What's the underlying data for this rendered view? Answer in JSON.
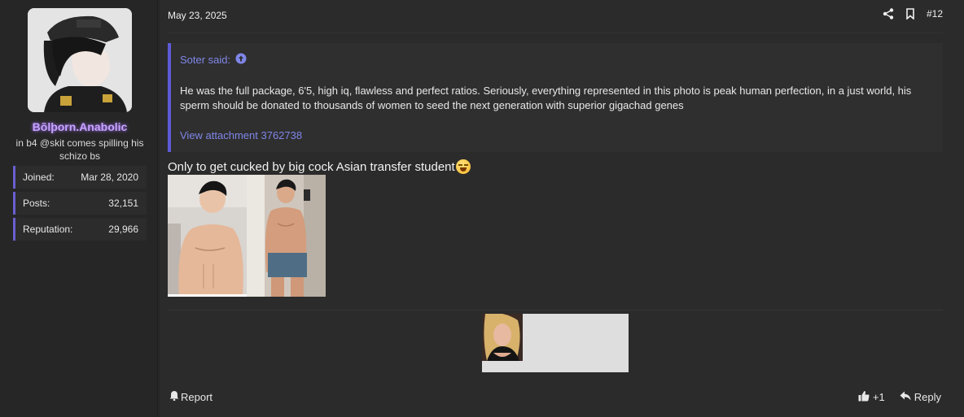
{
  "user": {
    "name": "Bõlþorn.Anabolic",
    "title": "in b4 @skit comes spilling his schizo bs",
    "stats": [
      {
        "label": "Joined:",
        "value": "Mar 28, 2020"
      },
      {
        "label": "Posts:",
        "value": "32,151"
      },
      {
        "label": "Reputation:",
        "value": "29,966"
      }
    ]
  },
  "post": {
    "date": "May 23, 2025",
    "number": "#12",
    "quote": {
      "author": "Soter said:",
      "text": "He was the full package, 6'5, high iq, flawless and perfect ratios. Seriously, everything represented in this photo is peak human perfection, in a just world, his sperm should be donated to thousands of women to seed the next generation with superior gigachad genes",
      "link": "View attachment 3762738"
    },
    "message": "Only to get cucked by big cock Asian transfer student",
    "message_emoji": "loudly-crying-face-emoji"
  },
  "footer": {
    "report": "Report",
    "like_count": "+1",
    "reply": "Reply"
  },
  "colors": {
    "accent": "#5d5bd6",
    "username": "#c9a3ff",
    "link": "#7f86e8"
  }
}
